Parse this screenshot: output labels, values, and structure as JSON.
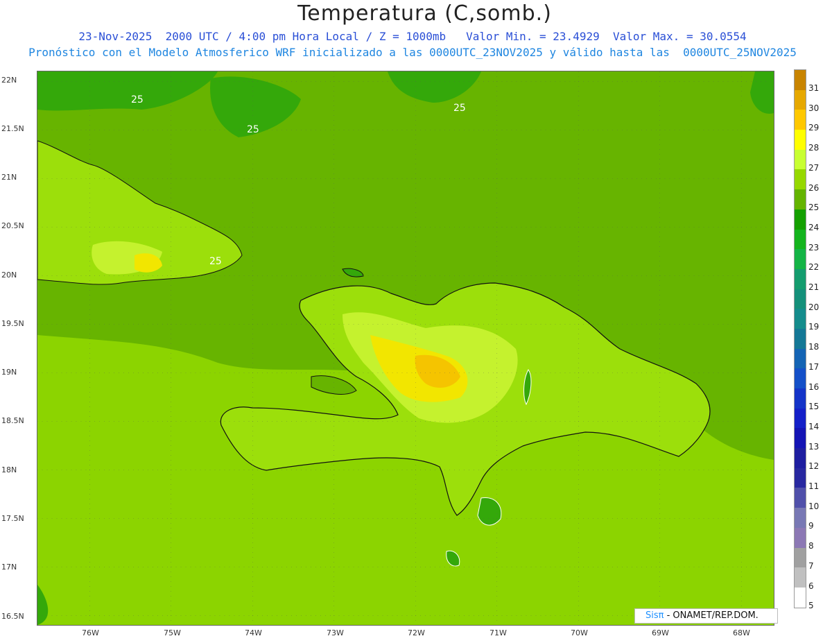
{
  "header": {
    "title": "Temperatura (C,somb.)",
    "line1": "23-Nov-2025  2000 UTC / 4:00 pm Hora Local / Z = 1000mb   Valor Min. = 23.4929  Valor Max. = 30.0554",
    "line2": "Pronóstico con el Modelo Atmosferico WRF inicializado a las 0000UTC_23NOV2025 y válido hasta las  0000UTC_25NOV2025"
  },
  "map": {
    "lat_labels": [
      "22N",
      "21.5N",
      "21N",
      "20.5N",
      "20N",
      "19.5N",
      "19N",
      "18.5N",
      "18N",
      "17.5N",
      "17N",
      "16.5N"
    ],
    "lon_labels": [
      "76W",
      "75W",
      "74W",
      "73W",
      "72W",
      "71W",
      "70W",
      "69W",
      "68W"
    ],
    "contour_labels": [
      "25",
      "25",
      "25",
      "25"
    ],
    "colors": {
      "ocean": "#8cd400",
      "t25": "#34a80a",
      "t26": "#67b400",
      "t27": "#9cdf0b",
      "t28": "#c5f22e",
      "t29": "#f2e600",
      "t30": "#f5c400"
    }
  },
  "colorbar": {
    "labels": [
      "31",
      "30",
      "29",
      "28",
      "27",
      "26",
      "25",
      "24",
      "23",
      "22",
      "21",
      "20",
      "19",
      "18",
      "17",
      "16",
      "15",
      "14",
      "13",
      "12",
      "11",
      "10",
      "9",
      "8",
      "7",
      "6",
      "5"
    ],
    "colors": [
      "#c88400",
      "#e6a800",
      "#ffc800",
      "#ffff00",
      "#c8ff32",
      "#96d800",
      "#64b400",
      "#14a000",
      "#14b41e",
      "#14b446",
      "#149c6e",
      "#14907a",
      "#148c8c",
      "#147896",
      "#1464b4",
      "#1450c8",
      "#1434c8",
      "#1420c8",
      "#1414b4",
      "#1e1ea0",
      "#2828a0",
      "#5050aa",
      "#7878b4",
      "#8c78b4",
      "#a0a0a0",
      "#c0c0c0",
      "#ffffff"
    ]
  },
  "credit": {
    "brand": "Sisπ",
    "rest": " - ONAMET/REP.DOM."
  }
}
